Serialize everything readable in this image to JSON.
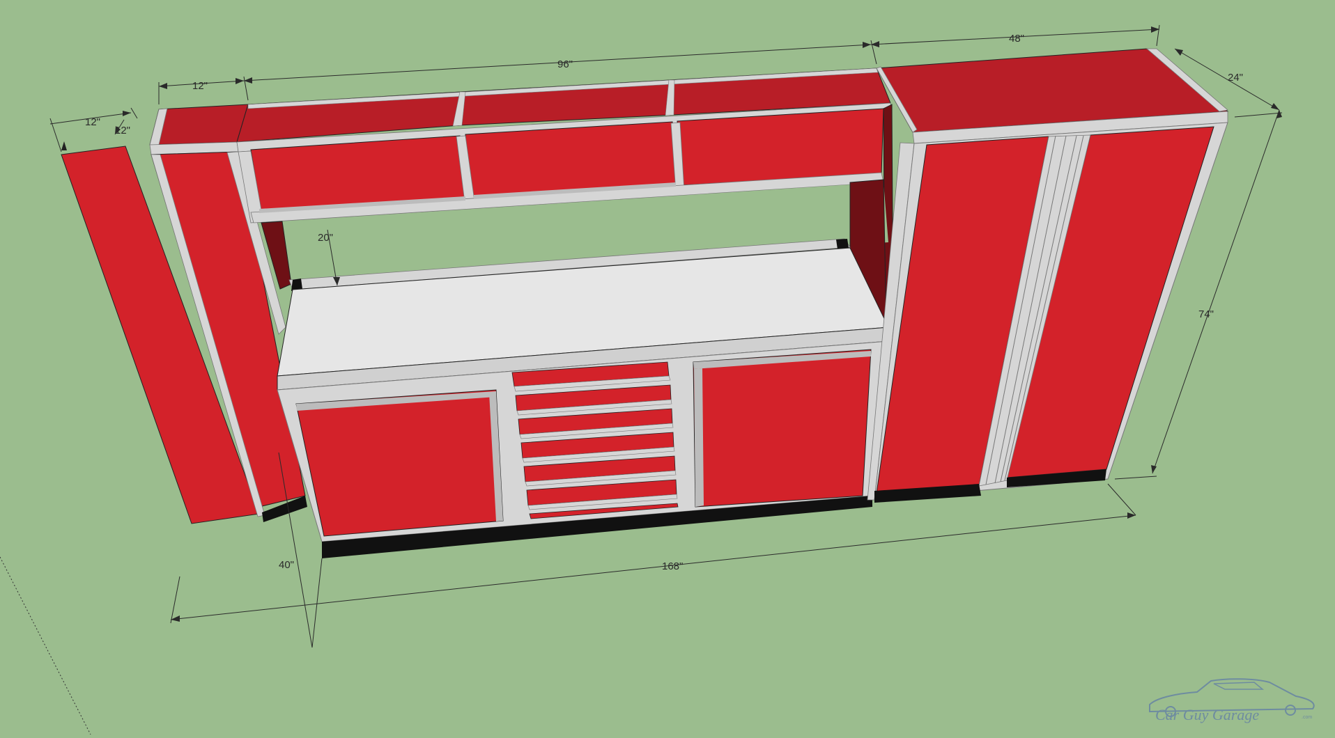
{
  "colors": {
    "background": "#9bbd8e",
    "cabinet_red": "#d3222a",
    "cabinet_red_top": "#b81e27",
    "cabinet_side_dark": "#6e1015",
    "frame_light": "#d6d6d6",
    "frame_mid": "#bcbcbc",
    "countertop": "#e6e6e6",
    "base_black": "#111111",
    "dimension_line": "#2a2a2a",
    "logo": "#6e8ca0"
  },
  "dimensions": {
    "side_depth_left": "12\"",
    "side_width_left": "12\"",
    "locker_width_top": "12\"",
    "upper_span": "96\"",
    "tall_span": "48\"",
    "tall_depth": "24\"",
    "height": "74\"",
    "upper_clearance": "20\"",
    "bench_depth": "40\"",
    "total_length": "168\""
  },
  "logo": {
    "name": "Car Guy Garage",
    "suffix": ".com"
  }
}
